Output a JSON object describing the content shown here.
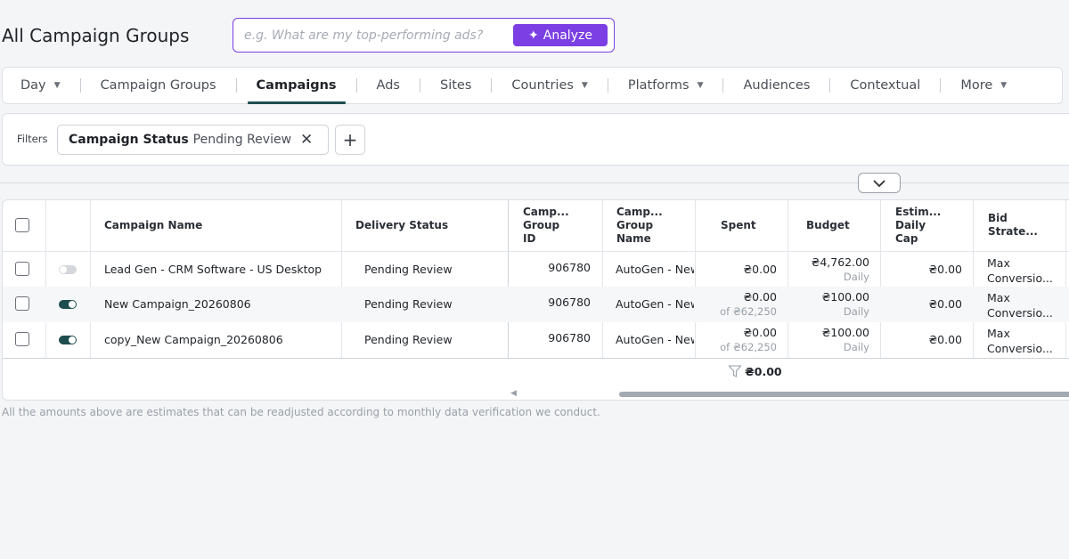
{
  "header": {
    "title": "All Campaign Groups",
    "search_placeholder": "e.g. What are my top-performing ads?",
    "analyze_label": "Analyze"
  },
  "tabs": [
    {
      "label": "Day",
      "dropdown": true
    },
    {
      "label": "Campaign Groups",
      "dropdown": false
    },
    {
      "label": "Campaigns",
      "dropdown": false,
      "active": true
    },
    {
      "label": "Ads",
      "dropdown": false
    },
    {
      "label": "Sites",
      "dropdown": false
    },
    {
      "label": "Countries",
      "dropdown": true
    },
    {
      "label": "Platforms",
      "dropdown": true
    },
    {
      "label": "Audiences",
      "dropdown": false
    },
    {
      "label": "Contextual",
      "dropdown": false
    },
    {
      "label": "More",
      "dropdown": true
    }
  ],
  "filters": {
    "label": "Filters",
    "chip_key": "Campaign Status",
    "chip_value": "Pending Review",
    "add_label": "+"
  },
  "table": {
    "columns": {
      "name": "Campaign Name",
      "delivery": "Delivery Status",
      "group_id": [
        "Camp...",
        "Group",
        "ID"
      ],
      "group_name": [
        "Camp...",
        "Group",
        "Name"
      ],
      "spent": "Spent",
      "budget": "Budget",
      "cap": [
        "Estim...",
        "Daily",
        "Cap"
      ],
      "bid": [
        "Bid",
        "Strate..."
      ]
    },
    "rows": [
      {
        "active": false,
        "name": "Lead Gen - CRM Software - US Desktop",
        "delivery": "Pending Review",
        "group_id": "906780",
        "group_name": "AutoGen - New",
        "spent": "₴0.00",
        "spent_sub": "",
        "budget": "₴4,762.00",
        "budget_sub": "Daily",
        "cap": "₴0.00",
        "bid": [
          "Max",
          "Conversio..."
        ]
      },
      {
        "active": true,
        "name": "New Campaign_20260806",
        "delivery": "Pending Review",
        "group_id": "906780",
        "group_name": "AutoGen - New",
        "spent": "₴0.00",
        "spent_sub": "of ₴62,250",
        "budget": "₴100.00",
        "budget_sub": "Daily",
        "cap": "₴0.00",
        "bid": [
          "Max",
          "Conversio..."
        ]
      },
      {
        "active": true,
        "name": "copy_New Campaign_20260806",
        "delivery": "Pending Review",
        "group_id": "906780",
        "group_name": "AutoGen - New",
        "spent": "₴0.00",
        "spent_sub": "of ₴62,250",
        "budget": "₴100.00",
        "budget_sub": "Daily",
        "cap": "₴0.00",
        "bid": [
          "Max",
          "Conversio..."
        ]
      }
    ],
    "total_spent": "₴0.00"
  },
  "footnote": "All the amounts above are estimates that can be readjusted according to monthly data verification we conduct."
}
